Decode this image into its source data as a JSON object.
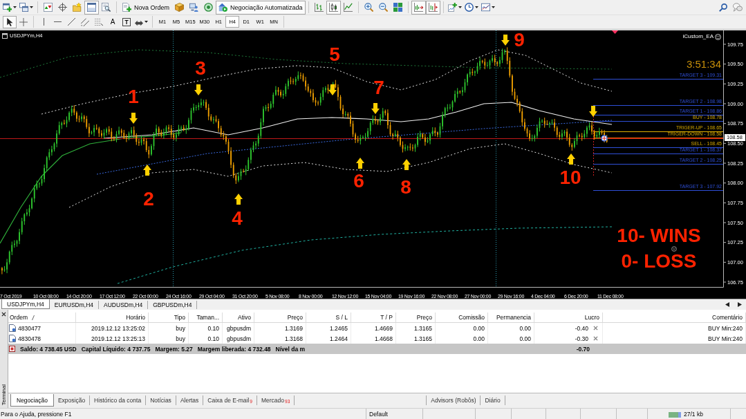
{
  "main_toolbar": {
    "panel_toggles": [
      {
        "on": false
      },
      {
        "on": false
      },
      {
        "on": false
      },
      {
        "on": true
      },
      {
        "on": false
      }
    ],
    "new_order_button": "Nova Ordem",
    "auto_trading_button": {
      "label": "Negociação Automatizada",
      "on": true
    },
    "chart_types": [
      {
        "selected": false
      },
      {
        "selected": true
      },
      {
        "selected": false
      }
    ],
    "view_toggles": [
      {
        "on": true
      },
      {
        "on": true
      }
    ]
  },
  "drawing_toolbar": {
    "cursor_modes": [
      {
        "selected": true
      },
      {
        "selected": false
      }
    ],
    "text_tools": [
      {
        "kind": "plain",
        "glyph": "A"
      },
      {
        "kind": "boxed",
        "glyph": "T"
      }
    ],
    "timeframes": [
      {
        "label": "M1",
        "selected": false
      },
      {
        "label": "M5",
        "selected": false
      },
      {
        "label": "M15",
        "selected": false
      },
      {
        "label": "M30",
        "selected": false
      },
      {
        "label": "H1",
        "selected": false
      },
      {
        "label": "H4",
        "selected": true
      },
      {
        "label": "D1",
        "selected": false
      },
      {
        "label": "W1",
        "selected": false
      },
      {
        "label": "MN",
        "selected": false
      }
    ]
  },
  "chart": {
    "title": "USDJPYm,H4",
    "expert_name": "iCustom_EA",
    "timer": "3:51:34",
    "levels": [
      {
        "label": "TARGET 3 - 109.31",
        "kind": "target",
        "color": "#2e4fd8"
      },
      {
        "label": "TARGET 2 - 108.98",
        "kind": "target",
        "color": "#2e4fd8"
      },
      {
        "label": "TARGET 1 - 108.86",
        "kind": "target",
        "color": "#2e4fd8"
      },
      {
        "label": "BUY - 108.78",
        "kind": "entry",
        "color": "#2e4fd8"
      },
      {
        "label": "TRIGER-UP - 108.65",
        "kind": "trigger",
        "color": "#e0b000"
      },
      {
        "label": "TRIGER-DOWN - 108.58",
        "kind": "trigger",
        "color": "#ff6a00"
      },
      {
        "label": "SELL - 108.45",
        "kind": "entry",
        "color": "#2e4fd8"
      },
      {
        "label": "TARGET 1 - 108.37",
        "kind": "target",
        "color": "#2e4fd8"
      },
      {
        "label": "TARGET 2 - 108.25",
        "kind": "target",
        "color": "#2e4fd8"
      },
      {
        "label": "TARGET 3 - 107.92",
        "kind": "target",
        "color": "#2e4fd8"
      }
    ],
    "signals": [
      {
        "label": "1",
        "kind": "down"
      },
      {
        "label": "2",
        "kind": "up"
      },
      {
        "label": "3",
        "kind": "down"
      },
      {
        "label": "4",
        "kind": "up"
      },
      {
        "label": "5",
        "kind": "down"
      },
      {
        "label": "6",
        "kind": "up"
      },
      {
        "label": "7",
        "kind": "down"
      },
      {
        "label": "8",
        "kind": "up"
      },
      {
        "label": "9",
        "kind": "down"
      },
      {
        "label": "10",
        "kind": "up"
      },
      {
        "kind": "down"
      }
    ],
    "score": [
      "10- WINS",
      "0- LOSS"
    ],
    "price_axis": [
      "109.75",
      "109.50",
      "109.25",
      "109.00",
      "108.75",
      "108.50",
      "108.25",
      "108.00",
      "107.75",
      "107.50",
      "107.25",
      "107.00",
      "106.75"
    ],
    "current_price": "108.58",
    "time_axis": [
      "7 Oct 2019",
      "10 Oct 08:00",
      "14 Oct 20:00",
      "17 Oct 12:00",
      "22 Oct 00:00",
      "24 Oct 16:00",
      "29 Oct 04:00",
      "31 Oct 20:00",
      "5 Nov 08:00",
      "8 Nov 00:00",
      "12 Nov 12:00",
      "15 Nov 04:00",
      "19 Nov 16:00",
      "22 Nov 08:00",
      "27 Nov 00:00",
      "29 Nov 16:00",
      "4 Dec 04:00",
      "6 Dec 20:00",
      "11 Dec 08:00"
    ]
  },
  "chart_tabs": [
    {
      "label": "USDJPYm,H4",
      "selected": true
    },
    {
      "label": "EURUSDm,H4",
      "selected": false
    },
    {
      "label": "AUDUSDm,H4",
      "selected": false
    },
    {
      "label": "GBPUSDm,H4",
      "selected": false
    }
  ],
  "terminal": {
    "title": "Terminal",
    "columns": [
      "Ordem",
      "Horário",
      "Tipo",
      "Taman...",
      "Ativo",
      "Preço",
      "S / L",
      "T / P",
      "Preço",
      "Comissão",
      "Permanencia",
      "Lucro",
      "Comentário"
    ],
    "rows": [
      {
        "cells": [
          "4830477",
          "2019.12.12 13:25:02",
          "buy",
          "0.10",
          "gbpusdm",
          "1.3169",
          "1.2465",
          "1.4669",
          "1.3165",
          "0.00",
          "0.00",
          "-0.40",
          "BUY Min:240"
        ]
      },
      {
        "cells": [
          "4830478",
          "2019.12.12 13:25:13",
          "buy",
          "0.10",
          "gbpusdm",
          "1.3168",
          "1.2464",
          "1.4668",
          "1.3165",
          "0.00",
          "0.00",
          "-0.30",
          "BUY Min:240"
        ]
      }
    ],
    "summary": {
      "items": [
        "Saldo: 4 738.45 USD",
        "Capital Líquido: 4 737.75",
        "Margem: 5.27",
        "Margem liberada: 4 732.48",
        "Nível da m"
      ],
      "profit": "-0.70"
    },
    "tabs": [
      {
        "label": "Negociação",
        "selected": true
      },
      {
        "label": "Exposição",
        "selected": false
      },
      {
        "label": "Histórico da conta",
        "selected": false
      },
      {
        "label": "Notícias",
        "selected": false
      },
      {
        "label": "Alertas",
        "selected": false
      },
      {
        "label": "Caixa de E-mail",
        "count": "9",
        "selected": false
      },
      {
        "label": "Mercado",
        "count": "93",
        "selected": false
      },
      {
        "label": "Advisors (Robôs)",
        "selected": false
      },
      {
        "label": "Diário",
        "selected": false
      }
    ]
  },
  "status_bar": {
    "help": "Para o Ajuda, pressione F1",
    "profile": "Default",
    "traffic": "27/1 kb"
  }
}
